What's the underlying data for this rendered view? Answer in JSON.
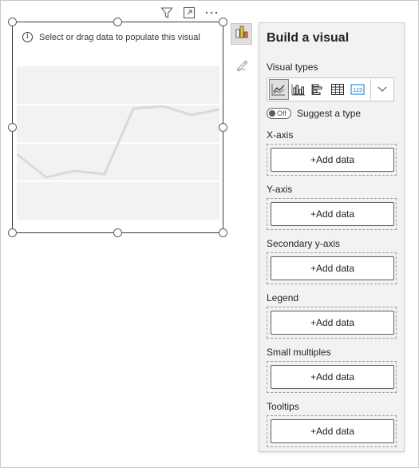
{
  "visual": {
    "placeholder_text": "Select or drag data to populate this visual",
    "header_icons": [
      "filter-icon",
      "focus-mode-icon",
      "more-options-icon"
    ],
    "ghost_line_color": "#d9d9d9",
    "ghost_band_color": "#f3f2f1"
  },
  "side_icons": [
    "build-visual-icon",
    "format-visual-icon"
  ],
  "pane": {
    "title": "Build a visual",
    "visual_types_label": "Visual types",
    "visual_types": [
      "line-chart-icon",
      "clustered-column-chart-icon",
      "clustered-bar-chart-icon",
      "table-icon",
      "card-icon"
    ],
    "selected_visual_type": "line-chart-icon",
    "suggest_toggle": {
      "state": "Off",
      "label": "Suggest a type"
    },
    "wells": [
      {
        "label": "X-axis",
        "button": "+Add data"
      },
      {
        "label": "Y-axis",
        "button": "+Add data"
      },
      {
        "label": "Secondary y-axis",
        "button": "+Add data"
      },
      {
        "label": "Legend",
        "button": "+Add data"
      },
      {
        "label": "Small multiples",
        "button": "+Add data"
      },
      {
        "label": "Tooltips",
        "button": "+Add data"
      }
    ]
  }
}
